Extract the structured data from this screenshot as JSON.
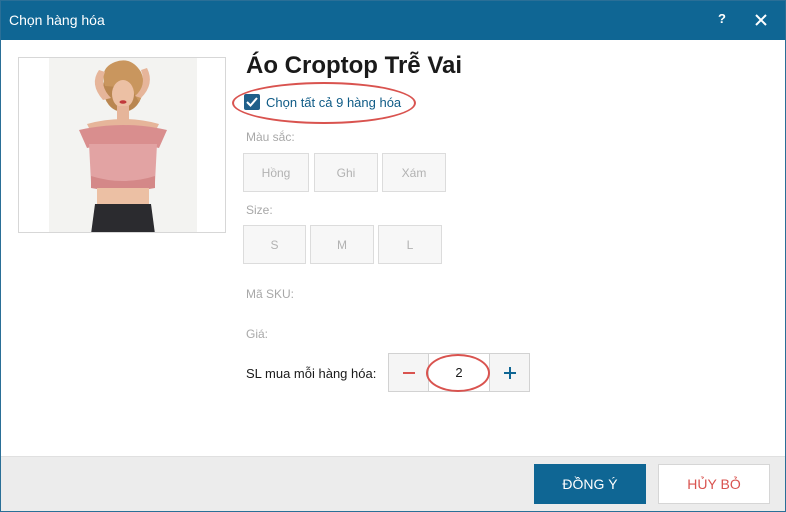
{
  "dialog": {
    "title": "Chọn hàng hóa",
    "help_label": "?"
  },
  "product": {
    "name": "Áo Croptop Trễ Vai",
    "select_all_label": "Chọn tất cả 9 hàng hóa",
    "select_all_checked": true
  },
  "color": {
    "label": "Màu sắc:",
    "options": [
      "Hồng",
      "Ghi",
      "Xám"
    ]
  },
  "size": {
    "label": "Size:",
    "options": [
      "S",
      "M",
      "L"
    ]
  },
  "sku": {
    "label": "Mã SKU:"
  },
  "price": {
    "label": "Giá:"
  },
  "quantity": {
    "label": "SL mua mỗi hàng hóa:",
    "value": "2"
  },
  "footer": {
    "ok_label": "ĐỒNG Ý",
    "cancel_label": "HỦY BỎ"
  },
  "colors": {
    "titlebar": "#0f6694",
    "accent": "#0f6694",
    "highlight": "#d9534f",
    "cancel_text": "#d9534f"
  },
  "icons": {
    "close": "close-icon",
    "check": "check-icon",
    "minus": "minus-icon",
    "plus": "plus-icon"
  }
}
